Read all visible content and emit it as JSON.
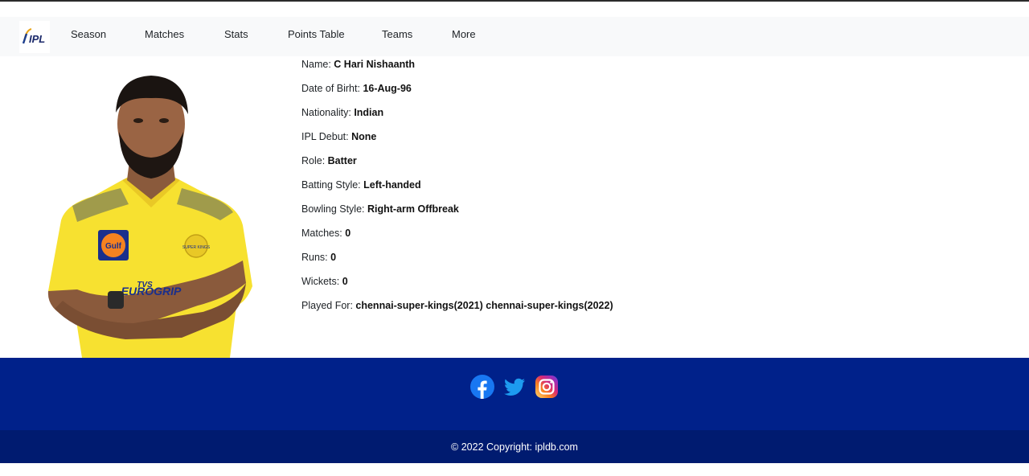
{
  "nav": {
    "logo_text": "IPL",
    "items": [
      {
        "label": "Season"
      },
      {
        "label": "Matches"
      },
      {
        "label": "Stats"
      },
      {
        "label": "Points Table"
      },
      {
        "label": "Teams"
      },
      {
        "label": "More"
      }
    ]
  },
  "player": {
    "jersey": {
      "sponsor": "Gulf",
      "brand_top": "TVS",
      "brand_bottom": "EUROGRIP",
      "badge": "SUPER KINGS"
    },
    "fields": [
      {
        "label": "Name: ",
        "value": "C Hari Nishaanth"
      },
      {
        "label": "Date of Birht: ",
        "value": "16-Aug-96"
      },
      {
        "label": "Nationality: ",
        "value": "Indian"
      },
      {
        "label": "IPL Debut: ",
        "value": "None"
      },
      {
        "label": "Role: ",
        "value": "Batter"
      },
      {
        "label": "Batting Style: ",
        "value": "Left-handed"
      },
      {
        "label": "Bowling Style: ",
        "value": "Right-arm Offbreak"
      },
      {
        "label": "Matches: ",
        "value": "0"
      },
      {
        "label": "Runs: ",
        "value": "0"
      },
      {
        "label": "Wickets: ",
        "value": "0"
      },
      {
        "label": "Played For: ",
        "value": "chennai-super-kings(2021) chennai-super-kings(2022)"
      }
    ]
  },
  "footer": {
    "socials": [
      "facebook-icon",
      "twitter-icon",
      "instagram-icon"
    ],
    "copyright": "© 2022 Copyright: ipldb.com"
  },
  "colors": {
    "navbar_bg": "#f8f9fa",
    "footer_bg": "#00218a",
    "copyright_bg": "#001b70",
    "jersey_yellow": "#f7e130"
  }
}
